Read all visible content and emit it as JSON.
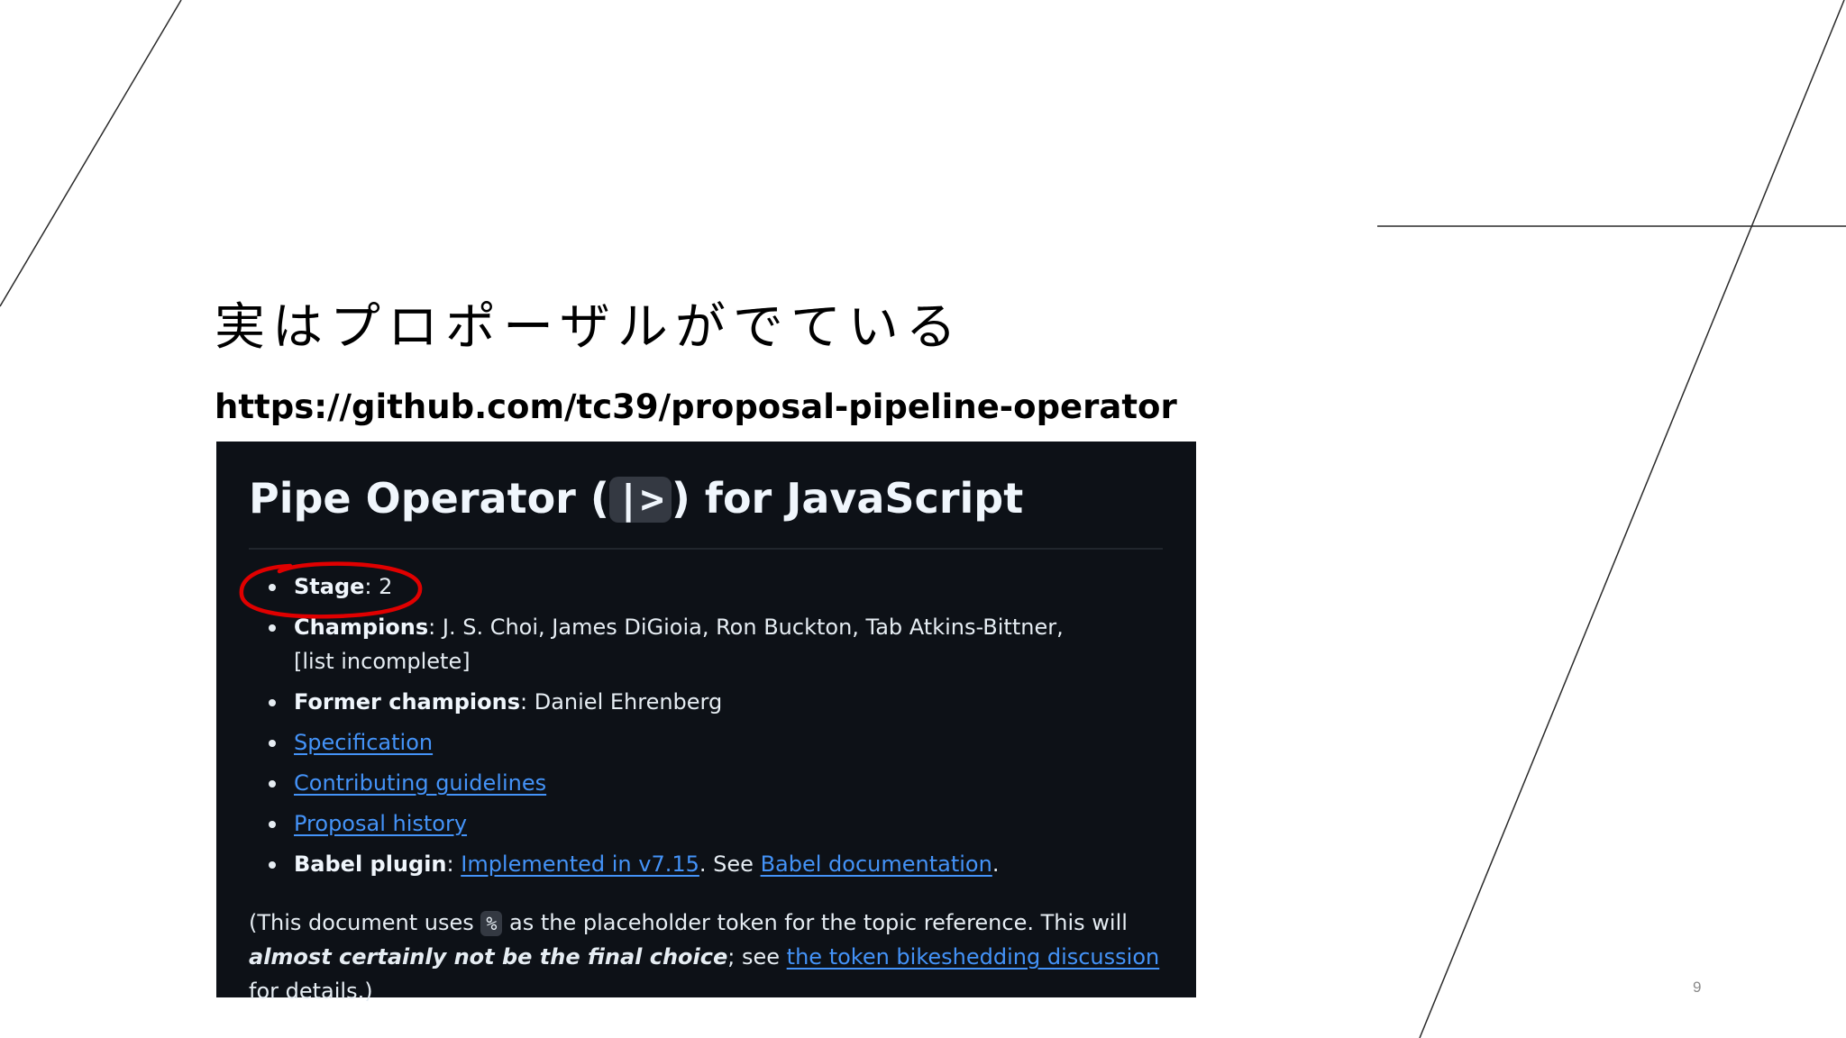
{
  "slide": {
    "title": "実はプロポーザルがでている",
    "url": "https://github.com/tc39/proposal-pipeline-operator",
    "page_number": "9"
  },
  "readme": {
    "heading_pre": "Pipe Operator (",
    "heading_code": "|>",
    "heading_post": ") for JavaScript",
    "stage_label": "Stage",
    "stage_value": ": 2",
    "champions_label": "Champions",
    "champions_value": ": J. S. Choi, James DiGioia, Ron Buckton, Tab Atkins-Bittner, [list incomplete]",
    "former_label": "Former champions",
    "former_value": ": Daniel Ehrenberg",
    "link_specification": "Specification",
    "link_contributing": "Contributing guidelines",
    "link_history": "Proposal history",
    "babel_label": "Babel plugin",
    "babel_sep": ": ",
    "babel_link_impl": "Implemented in v7.15",
    "babel_mid": ". See ",
    "babel_link_docs": "Babel documentation",
    "babel_end": ".",
    "para_1": "(This document uses ",
    "para_code": "%",
    "para_2": " as the placeholder token for the topic reference. This will ",
    "para_emph": "almost certainly not be the final choice",
    "para_3": "; see ",
    "para_link": "the token bikeshedding discussion",
    "para_4": " for details.)"
  },
  "colors": {
    "annotation": "#e00000",
    "background_dark": "#0d1117",
    "link": "#4493f8"
  }
}
